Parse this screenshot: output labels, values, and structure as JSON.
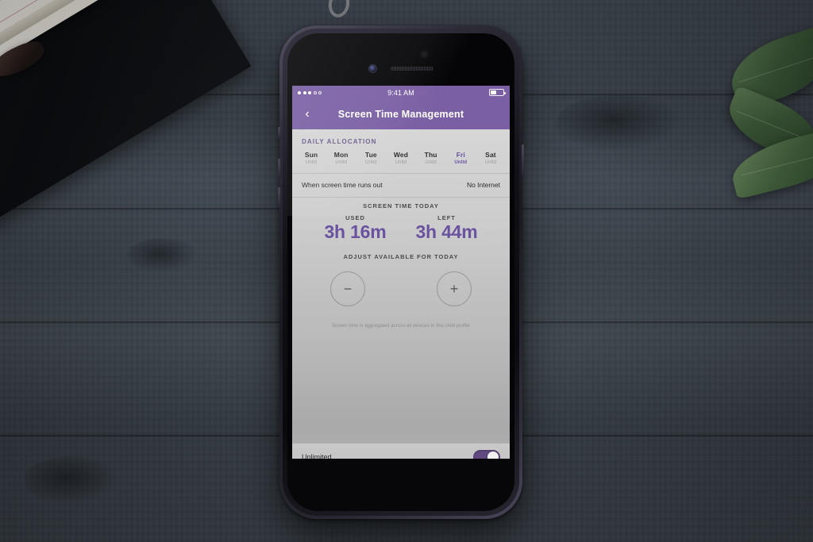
{
  "scene": {
    "objects": {
      "notepad": "notepad",
      "clipboard": "clipboard",
      "pen": "pen",
      "leaves": "plant-leaves",
      "surface": "dark-wood-table"
    }
  },
  "phone": {
    "hardware": {
      "camera": "front-camera",
      "speaker": "earpiece-speaker",
      "light_sensor": "ambient-light-sensor",
      "power_button": "power-button",
      "volume_up": "volume-up-button",
      "volume_down": "volume-down-button",
      "mute_switch": "mute-switch"
    }
  },
  "status_bar": {
    "signal_dots_filled": 3,
    "signal_dots_empty": 2,
    "time": "9:41 AM",
    "battery_icon": "battery-icon",
    "battery_level_pct": 45
  },
  "nav": {
    "back_icon": "‹",
    "title": "Screen Time Management"
  },
  "daily_allocation": {
    "section_label": "DAILY ALLOCATION",
    "days": [
      {
        "name": "Sun",
        "value": "Unltd",
        "active": false
      },
      {
        "name": "Mon",
        "value": "Unltd",
        "active": false
      },
      {
        "name": "Tue",
        "value": "Unltd",
        "active": false
      },
      {
        "name": "Wed",
        "value": "Unltd",
        "active": false
      },
      {
        "name": "Thu",
        "value": "Unltd",
        "active": false
      },
      {
        "name": "Fri",
        "value": "Unltd",
        "active": true
      },
      {
        "name": "Sat",
        "value": "Unltd",
        "active": false
      }
    ]
  },
  "runs_out": {
    "label": "When screen time runs out",
    "value": "No Internet"
  },
  "screen_time_today": {
    "heading": "SCREEN TIME TODAY",
    "used_caption": "USED",
    "used_value": "3h 16m",
    "left_caption": "LEFT",
    "left_value": "3h 44m"
  },
  "adjust": {
    "heading": "ADJUST AVAILABLE FOR TODAY",
    "minus_label": "−",
    "plus_label": "+",
    "minus_icon": "minus-icon",
    "plus_icon": "plus-icon"
  },
  "footnote": {
    "text": "Screen time is aggregated across all devices in this child profile"
  },
  "bottom_bar": {
    "label": "Unlimited",
    "toggle_on": true
  },
  "colors": {
    "brand_purple": "#7a5fa4",
    "value_purple": "#6b52a0",
    "toggle_on": "#604a80",
    "screen_bg": "#c4c4c4",
    "text_dark": "#2b2b2b",
    "text_muted": "#9b9b9b"
  }
}
